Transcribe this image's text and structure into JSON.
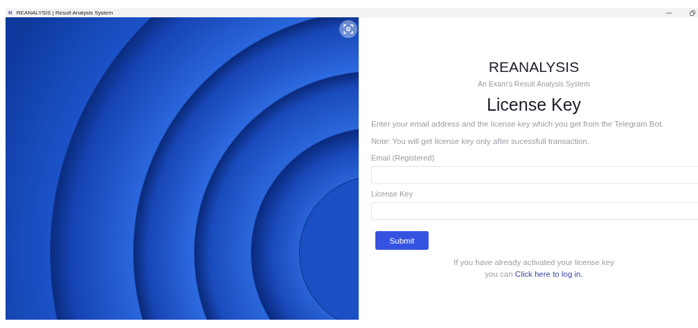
{
  "window": {
    "logo": "R",
    "title": "REANALYSIS | Result Analysis System"
  },
  "form": {
    "brand": "REANALYSIS",
    "tagline": "An Exam's Result Analysis System",
    "heading": "License Key",
    "instructions": [
      "Enter your email address and the license key which you get from the Telegram Bot.",
      "Note: You will get license key only after sucessfull transaction."
    ],
    "fields": [
      {
        "label": "Email (Registered)"
      },
      {
        "label": "License Key"
      }
    ],
    "submit": "Submit",
    "login_prompt": {
      "line_1": "If you have already activated your license key",
      "line_2": "you can",
      "link": "Click here to log in."
    }
  }
}
